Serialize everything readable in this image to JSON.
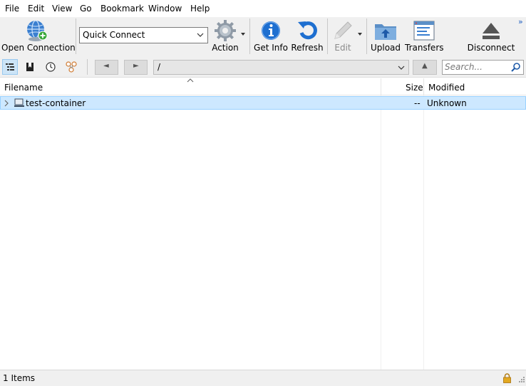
{
  "menu": [
    "File",
    "Edit",
    "View",
    "Go",
    "Bookmark",
    "Window",
    "Help"
  ],
  "toolbar": {
    "open_connection": "Open Connection",
    "quick_connect": "Quick Connect",
    "action": "Action",
    "get_info": "Get Info",
    "refresh": "Refresh",
    "edit": "Edit",
    "upload": "Upload",
    "transfers": "Transfers",
    "disconnect": "Disconnect",
    "overflow": "»"
  },
  "navbar": {
    "back": "◄",
    "forward": "►",
    "path": "/",
    "up": "▲",
    "search_placeholder": "Search..."
  },
  "columns": {
    "filename": "Filename",
    "size": "Size",
    "modified": "Modified"
  },
  "files": [
    {
      "name": "test-container",
      "size": "--",
      "modified": "Unknown"
    }
  ],
  "status": "1 Items",
  "icons": {
    "open_connection": "globe-plus-icon",
    "action": "gear-icon",
    "get_info": "info-icon",
    "refresh": "refresh-icon",
    "edit": "pencil-icon",
    "upload": "upload-folder-icon",
    "transfers": "transfers-icon",
    "disconnect": "eject-icon"
  },
  "colors": {
    "selection": "#cde8ff",
    "accent": "#1e6fd0"
  }
}
